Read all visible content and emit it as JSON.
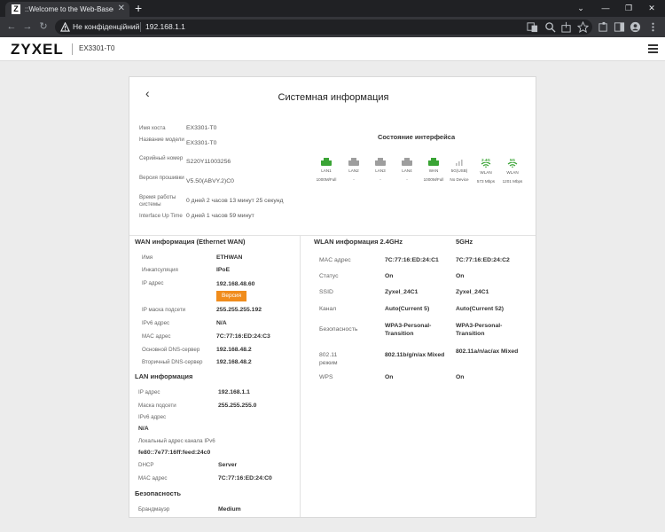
{
  "browser": {
    "tab_title": "::Welcome to the Web-Based Co",
    "favicon_letter": "Z",
    "security_label": "Не конфіденційний",
    "url": "192.168.1.1"
  },
  "header": {
    "brand": "ZYXEL",
    "model": "EX3301-T0"
  },
  "page": {
    "title": "Системная информация"
  },
  "system_info": [
    {
      "label": "Имя хоста",
      "value": "EX3301-T0"
    },
    {
      "label": "Название модели",
      "value": "EX3301-T0"
    },
    {
      "label": "Серийный номер",
      "value": "S220Y11003256"
    },
    {
      "label": "Версия прошивки",
      "value": "V5.50(ABVY.2)C0"
    },
    {
      "label": "Время работы системы",
      "value": "0 дней 2 часов 13 минут 25 секунд"
    },
    {
      "label": "Interface Up Time",
      "value": "0 дней 1 часов 59 минут"
    }
  ],
  "interfaces": {
    "title": "Состояние интерфейса",
    "ports": [
      {
        "name": "LAN1",
        "speed": "1000M/Full",
        "status": "up"
      },
      {
        "name": "LAN2",
        "speed": "-",
        "status": "down"
      },
      {
        "name": "LAN3",
        "speed": "-",
        "status": "down"
      },
      {
        "name": "LAN4",
        "speed": "-",
        "status": "down"
      },
      {
        "name": "WAN",
        "speed": "1000M/Full",
        "status": "up"
      },
      {
        "name": "5G(USB)",
        "speed": "No Device",
        "status": "none"
      },
      {
        "name": "WLAN",
        "speed": "573 Mbps",
        "status": "wifi",
        "band": "2.4G"
      },
      {
        "name": "WLAN",
        "speed": "1201 Mbps",
        "status": "wifi",
        "band": "5G"
      }
    ],
    "colors": {
      "up": "#3aa435",
      "down": "#9e9e9e"
    }
  },
  "wan": {
    "title": "WAN информация (Ethernet WAN)",
    "rows": [
      {
        "label": "Имя",
        "value": "ETHWAN"
      },
      {
        "label": "Инкапсуляция",
        "value": "IPoE"
      },
      {
        "label": "IP адрес",
        "value": "192.168.48.60"
      },
      {
        "label": "IP маска подсети",
        "value": "255.255.255.192"
      },
      {
        "label": "IPv6 адрес",
        "value": "N/A"
      },
      {
        "label": "MAC адрес",
        "value": "7C:77:16:ED:24:C3"
      },
      {
        "label": "Основной DNS-сервер",
        "value": "192.168.48.2"
      },
      {
        "label": "Вторичный DNS-сервер",
        "value": "192.168.48.2"
      }
    ],
    "version_button": "Версия"
  },
  "lan": {
    "title": "LAN информация",
    "ip_label": "IP адрес",
    "ip": "192.168.1.1",
    "mask_label": "Маска подсети",
    "mask": "255.255.255.0",
    "ipv6_label": "IPv6 адрес",
    "ipv6": "N/A",
    "ll_label": "Локальный адрес канала IPv6",
    "ll": "fe80::7e77:16ff:feed:24c0",
    "dhcp_label": "DHCP",
    "dhcp": "Server",
    "mac_label": "MAC адрес",
    "mac": "7C:77:16:ED:24:C0"
  },
  "security": {
    "title": "Безопасность",
    "fw_label": "Брандмауэр",
    "fw": "Medium"
  },
  "wlan": {
    "title": "WLAN информация 2.4GHz",
    "col5": "5GHz",
    "rows": [
      {
        "label": "MAC адрес",
        "v24": "7C:77:16:ED:24:C1",
        "v5": "7C:77:16:ED:24:C2"
      },
      {
        "label": "Статус",
        "v24": "On",
        "v5": "On"
      },
      {
        "label": "SSID",
        "v24": "Zyxel_24C1",
        "v5": "Zyxel_24C1"
      },
      {
        "label": "Канал",
        "v24": "Auto(Current 5)",
        "v5": "Auto(Current 52)"
      },
      {
        "label": "Безопасность",
        "v24": "WPA3-Personal-Transition",
        "v5": "WPA3-Personal-Transition"
      },
      {
        "label": "802.11 режим",
        "v24": "802.11b/g/n/ax Mixed",
        "v5": "802.11a/n/ac/ax Mixed"
      },
      {
        "label": "WPS",
        "v24": "On",
        "v5": "On"
      }
    ]
  }
}
